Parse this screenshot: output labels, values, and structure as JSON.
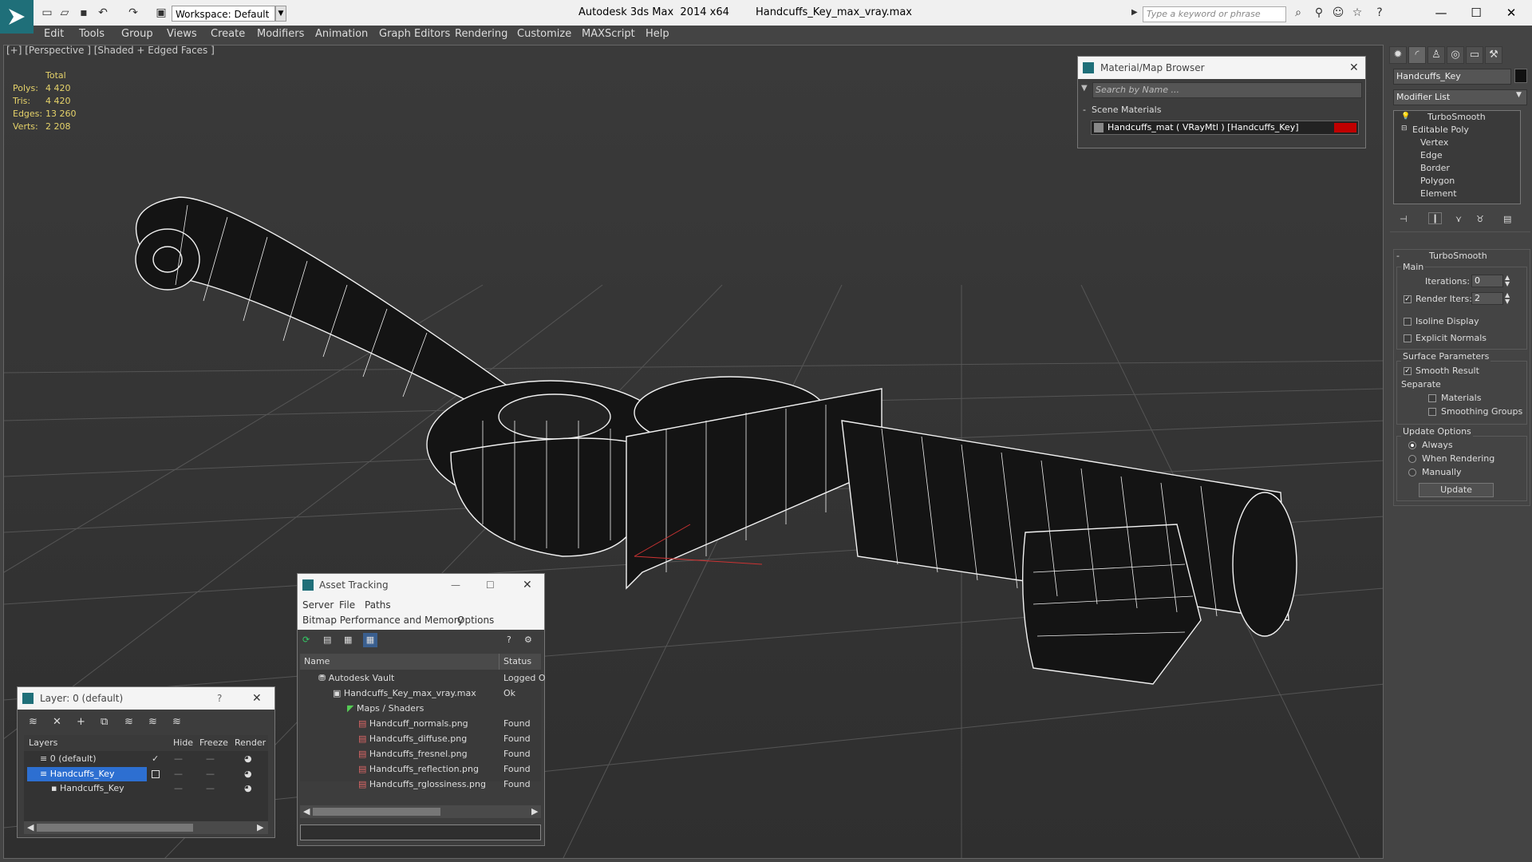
{
  "titlebar": {
    "workspace": "Workspace: Default",
    "app_title": "Autodesk 3ds Max  2014 x64",
    "file_name": "Handcuffs_Key_max_vray.max",
    "search_placeholder": "Type a keyword or phrase"
  },
  "menu": [
    "Edit",
    "Tools",
    "Group",
    "Views",
    "Create",
    "Modifiers",
    "Animation",
    "Graph Editors",
    "Rendering",
    "Customize",
    "MAXScript",
    "Help"
  ],
  "viewport": {
    "label": "[+] [Perspective ] [Shaded + Edged Faces ]",
    "stats": {
      "header": "Total",
      "rows": [
        {
          "label": "Polys:",
          "value": "4 420"
        },
        {
          "label": "Tris:",
          "value": "4 420"
        },
        {
          "label": "Edges:",
          "value": "13 260"
        },
        {
          "label": "Verts:",
          "value": "2 208"
        }
      ]
    }
  },
  "material_browser": {
    "title": "Material/Map Browser",
    "search": "Search by Name ...",
    "section": "Scene Materials",
    "item": "Handcuffs_mat  ( VRayMtl ) [Handcuffs_Key]",
    "swatch_color": "#c00000"
  },
  "command_panel": {
    "object_name": "Handcuffs_Key",
    "modifier_list": "Modifier List",
    "stack": [
      "TurboSmooth",
      "Editable Poly",
      "Vertex",
      "Edge",
      "Border",
      "Polygon",
      "Element"
    ],
    "rollout_title": "TurboSmooth",
    "main_label": "Main",
    "iterations_label": "Iterations:",
    "iterations_value": "0",
    "render_iters_label": "Render Iters:",
    "render_iters_value": "2",
    "isoline": "Isoline Display",
    "explicit_normals": "Explicit Normals",
    "surface_params": "Surface Parameters",
    "smooth_result": "Smooth Result",
    "separate": "Separate",
    "materials": "Materials",
    "smoothing_groups": "Smoothing Groups",
    "update_options": "Update Options",
    "always": "Always",
    "when_rendering": "When Rendering",
    "manually": "Manually",
    "update_button": "Update"
  },
  "asset_tracking": {
    "title": "Asset Tracking",
    "menu1": [
      "Server",
      "File",
      "Paths"
    ],
    "menu2": [
      "Bitmap Performance and Memory",
      "Options"
    ],
    "col_name": "Name",
    "col_status": "Status",
    "rows": [
      {
        "name": "Autodesk Vault",
        "status": "Logged O"
      },
      {
        "name": "Handcuffs_Key_max_vray.max",
        "status": "Ok"
      },
      {
        "name": "Maps / Shaders",
        "status": ""
      },
      {
        "name": "Handcuff_normals.png",
        "status": "Found"
      },
      {
        "name": "Handcuffs_diffuse.png",
        "status": "Found"
      },
      {
        "name": "Handcuffs_fresnel.png",
        "status": "Found"
      },
      {
        "name": "Handcuffs_reflection.png",
        "status": "Found"
      },
      {
        "name": "Handcuffs_rglossiness.png",
        "status": "Found"
      }
    ]
  },
  "layer_dialog": {
    "title": "Layer: 0 (default)",
    "help": "?",
    "col_layers": "Layers",
    "col_hide": "Hide",
    "col_freeze": "Freeze",
    "col_render": "Render",
    "rows": [
      {
        "name": "0 (default)"
      },
      {
        "name": "Handcuffs_Key"
      },
      {
        "name": "Handcuffs_Key"
      }
    ]
  }
}
